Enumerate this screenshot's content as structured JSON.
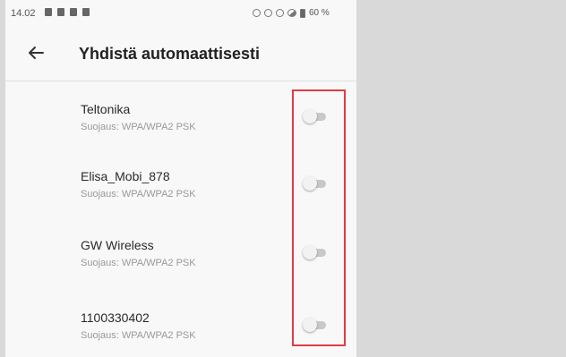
{
  "status_bar": {
    "time": "14.02",
    "battery": "60 %"
  },
  "app_bar": {
    "title": "Yhdistä automaattisesti",
    "back_icon": "arrow-left-icon"
  },
  "networks": [
    {
      "name": "Teltonika",
      "security": "Suojaus: WPA/WPA2 PSK",
      "auto_connect": false
    },
    {
      "name": "Elisa_Mobi_878",
      "security": "Suojaus: WPA/WPA2 PSK",
      "auto_connect": false
    },
    {
      "name": "GW Wireless",
      "security": "Suojaus: WPA/WPA2 PSK",
      "auto_connect": false
    },
    {
      "name": "1100330402",
      "security": "Suojaus: WPA/WPA2 PSK",
      "auto_connect": false
    }
  ],
  "colors": {
    "highlight": "#e03c46",
    "background": "#f8f8f8"
  }
}
